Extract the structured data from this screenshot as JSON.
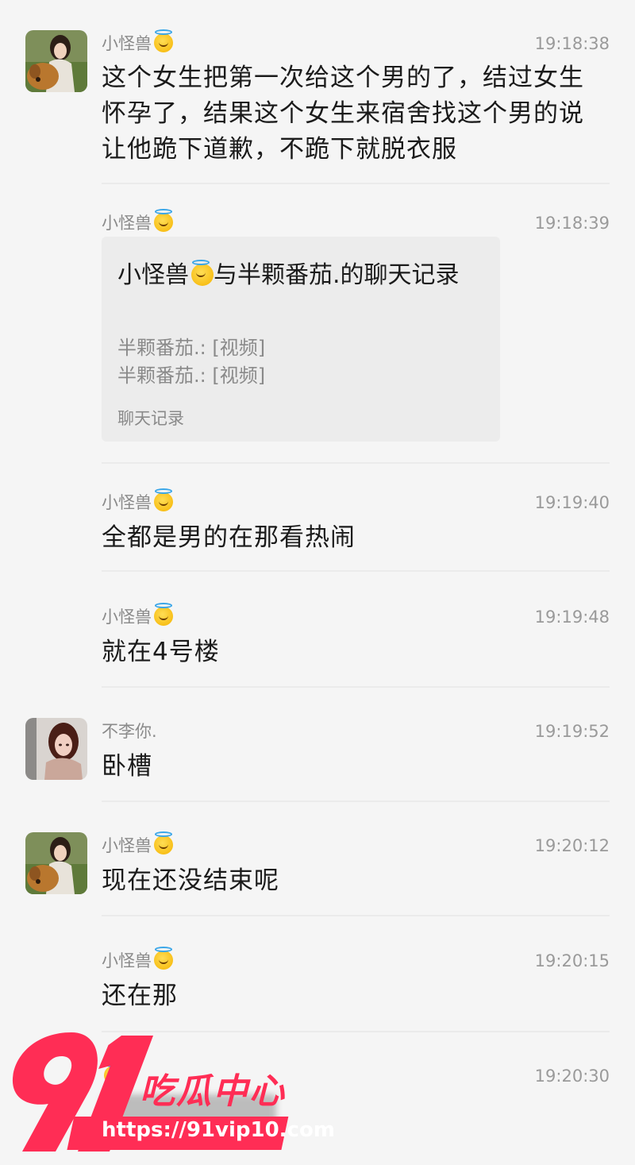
{
  "messages": [
    {
      "sender": "小怪兽",
      "time": "19:18:38",
      "text": "这个女生把第一次给这个男的了，结过女生怀孕了，结果这个女生来宿舍找这个男的说让他跪下道歉，不跪下就脱衣服"
    },
    {
      "sender": "小怪兽",
      "time": "19:18:39"
    },
    {
      "sender": "小怪兽",
      "time": "19:19:40",
      "text": "全都是男的在那看热闹"
    },
    {
      "sender": "小怪兽",
      "time": "19:19:48",
      "text": "就在4号楼"
    },
    {
      "sender": "不李你.",
      "time": "19:19:52",
      "text": "卧槽"
    },
    {
      "sender": "小怪兽",
      "time": "19:20:12",
      "text": "现在还没结束呢"
    },
    {
      "sender": "小怪兽",
      "time": "19:20:15",
      "text": "还在那"
    },
    {
      "sender": "",
      "time": "19:20:30"
    }
  ],
  "chat_record": {
    "title_prefix": "小怪兽",
    "title_suffix": "与半颗番茄.的聊天记录",
    "lines": [
      "半颗番茄.: [视频]",
      "半颗番茄.: [视频]"
    ],
    "footer": "聊天记录"
  },
  "watermark": {
    "logo_number": "91",
    "logo_text": "吃瓜中心",
    "url": "https://91vip10.com",
    "color": "#ff2d55"
  }
}
